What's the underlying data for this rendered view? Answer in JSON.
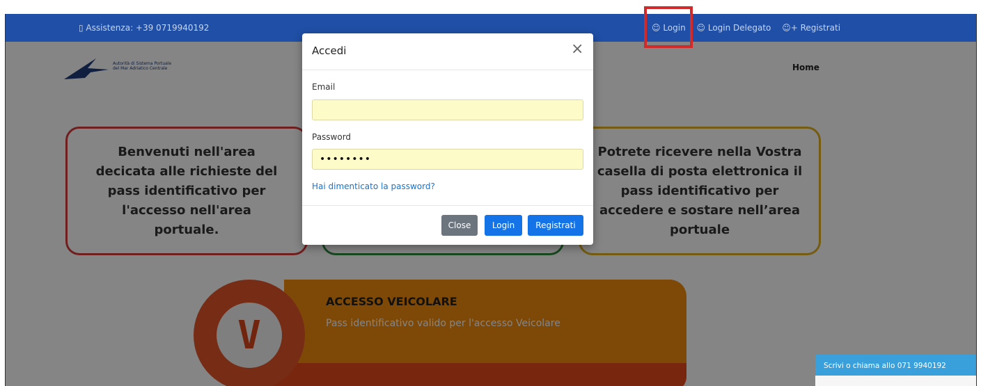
{
  "topbar": {
    "assistance": "▯ Assistenza: +39 0719940192",
    "links": [
      "☺ Login",
      "☺ Login Delegato",
      "☺+ Registrati"
    ]
  },
  "header": {
    "logo_line1": "Autorità di Sistema Portuale",
    "logo_line2": "del Mar Adriatico Centrale",
    "nav_home": "Home"
  },
  "cards": {
    "left": "Benvenuti nell'area decicata alle richieste del pass identificativo per l'accesso nell'area portuale.",
    "middle": "",
    "right": "Potrete ricevere nella Vostra casella di posta elettronica il pass identificativo per accedere e sostare nell’area portuale"
  },
  "vehicle": {
    "letter": "V",
    "title": "ACCESSO VEICOLARE",
    "subtitle": "Pass identificativo valido per l'accesso Veicolare"
  },
  "chat": {
    "label": "Scrivi o chiama allo 071 9940192"
  },
  "modal": {
    "title": "Accedi",
    "close_glyph": "×",
    "email_label": "Email",
    "email_value": "",
    "password_label": "Password",
    "password_value": "••••••••",
    "forgot": "Hai dimenticato la password?",
    "btn_close": "Close",
    "btn_login": "Login",
    "btn_register": "Registrati"
  },
  "colors": {
    "topbar": "#1f4fa6",
    "primary": "#1473e6",
    "highlight": "#d02a2a",
    "card_red": "#d93b3b",
    "card_green": "#2e8b3e",
    "card_yellow": "#e0b020",
    "vehicle_orange": "#f28a0c"
  }
}
